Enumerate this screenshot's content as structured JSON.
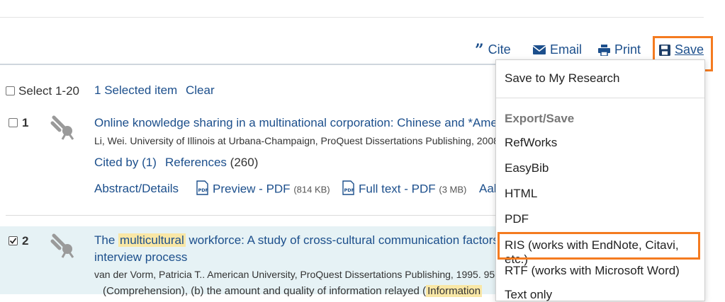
{
  "toolbar": {
    "cite": "Cite",
    "email": "Email",
    "print": "Print",
    "save": "Save"
  },
  "selection": {
    "select_label": "Select 1-20",
    "selected_count": "1",
    "selected_label": "Selected item",
    "clear": "Clear"
  },
  "results": [
    {
      "num": "1",
      "title": "Online knowledge sharing in a multinational corporation: Chinese and *Americ",
      "meta": "Li, Wei. University of Illinois at Urbana-Champaign, ProQuest Dissertations Publishing, 2008",
      "cited_by_label": "Cited by",
      "cited_by_count": "(1)",
      "references_label": "References",
      "references_count": "(260)",
      "abstract": "Abstract/Details",
      "preview": "Preview - PDF",
      "preview_size": "(814 KB)",
      "fulltext": "Full text - PDF",
      "fulltext_size": "(3 MB)",
      "extra": "Aal"
    },
    {
      "num": "2",
      "title_pre": "The",
      "title_hl": "multicultural",
      "title_post": "workforce: A study of cross-cultural communication factors",
      "title_line2": "interview process",
      "meta": "van der Vorm, Patricia T.. American University, ProQuest Dissertations Publishing, 1995. 95",
      "snippet_pre": "(Comprehension), (b) the amount and quality of information relayed (",
      "snippet_hl": "Information"
    }
  ],
  "save_menu": {
    "save_to_research": "Save to My Research",
    "export_header": "Export/Save",
    "items": [
      "RefWorks",
      "EasyBib",
      "HTML",
      "PDF",
      "RIS (works with EndNote, Citavi, etc.)",
      "RTF (works with Microsoft Word)",
      "Text only"
    ]
  },
  "colors": {
    "link": "#1c4f8c",
    "highlight_box": "#f47b20",
    "selected_row_bg": "#e6f2f5",
    "term_highlight": "#f9e7a6"
  }
}
